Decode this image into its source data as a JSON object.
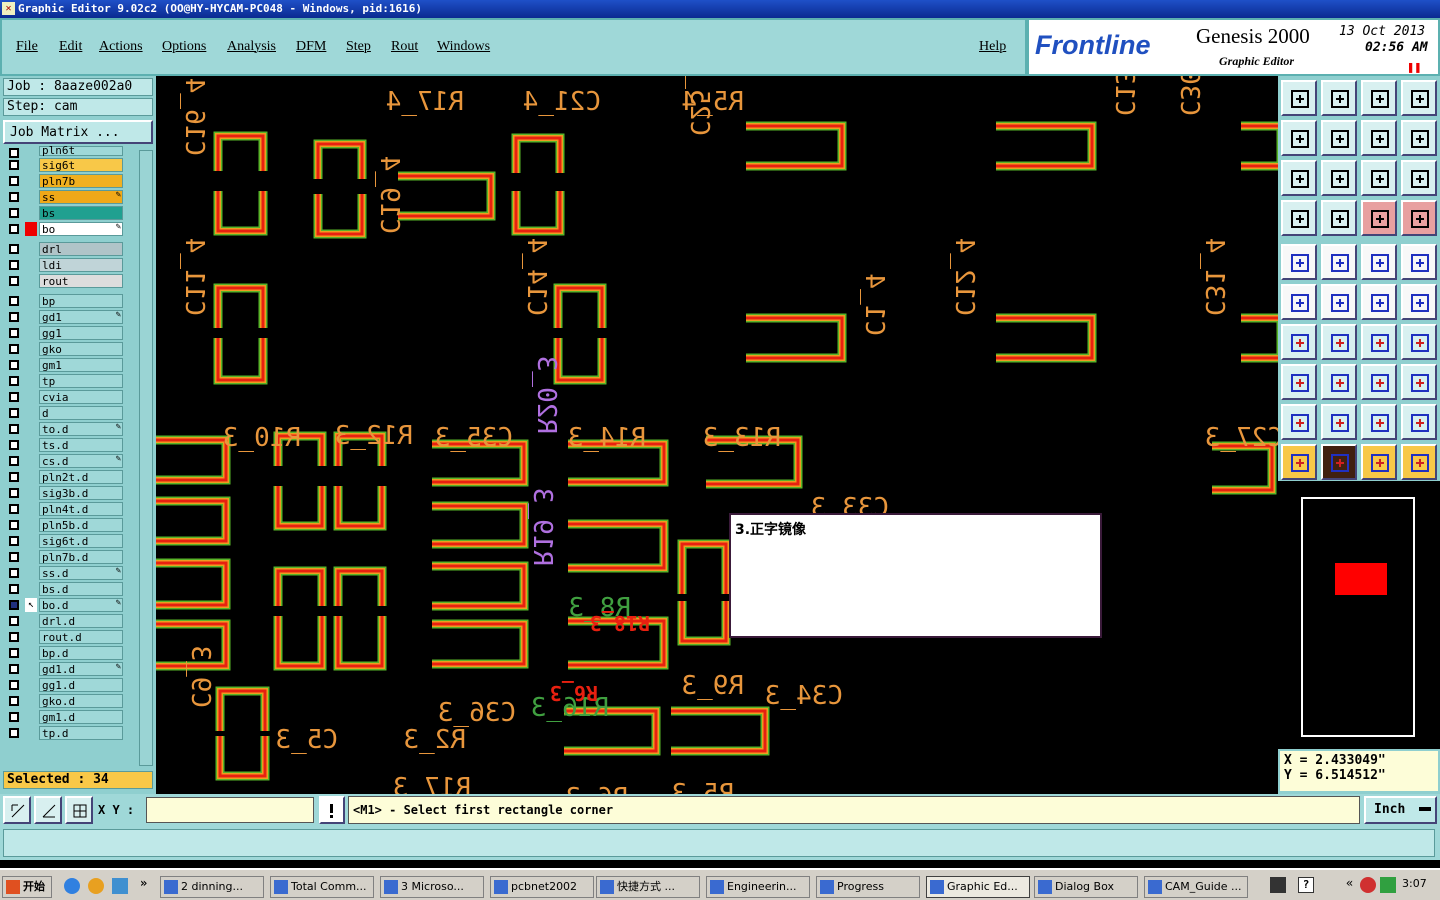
{
  "window": {
    "title": "Graphic Editor 9.02c2 (OO@HY-HYCAM-PC048 - Windows, pid:1616)"
  },
  "menu": [
    "File",
    "Edit",
    "Actions",
    "Options",
    "Analysis",
    "DFM",
    "Step",
    "Rout",
    "Windows"
  ],
  "help": "Help",
  "brand": {
    "logo": "Frontline",
    "product": "Genesis 2000",
    "subtitle": "Graphic Editor",
    "date": "13 Oct 2013",
    "time": "02:56 AM"
  },
  "job": {
    "job_label": "Job : 8aaze002a0",
    "step_label": "Step: cam",
    "matrix_button": "Job Matrix ..."
  },
  "layers": [
    "pln6t",
    "sig6t",
    "pln7b",
    "ss",
    "bs",
    "bo",
    "drl",
    "ldi",
    "rout",
    "bp",
    "gd1",
    "gg1",
    "gko",
    "gm1",
    "tp",
    "cvia",
    "d",
    "to.d",
    "ts.d",
    "cs.d",
    "pln2t.d",
    "sig3b.d",
    "pln4t.d",
    "pln5b.d",
    "sig6t.d",
    "pln7b.d",
    "ss.d",
    "bs.d",
    "bo.d",
    "drl.d",
    "rout.d",
    "bp.d",
    "gd1.d",
    "gg1.d",
    "gko.d",
    "gm1.d",
    "tp.d"
  ],
  "selected": "Selected : 34",
  "coords": {
    "x": "X = 2.433049\"",
    "y": "Y = 6.514512\""
  },
  "dialog": {
    "text": "3.正字镜像"
  },
  "prompt": {
    "xy_label": "X Y :",
    "xy_value": "",
    "message": "<M1> - Select first rectangle corner",
    "units": "Inch"
  },
  "canvas_labels": [
    "R17_4",
    "C21_4",
    "R5_4",
    "C19_4",
    "C25_4",
    "C16_4",
    "C13_4",
    "C30_4",
    "C11_4",
    "C14_4",
    "C1_4",
    "C12_4",
    "C31_4",
    "R10_3",
    "R12_3",
    "C35_3",
    "R14_3",
    "R13_3",
    "C33_3",
    "R8_3",
    "R9_3",
    "C34_3",
    "R16_3",
    "C36_3",
    "R2_3",
    "C5_3",
    "R17_3",
    "R6_3",
    "R5_3",
    "C9_3",
    "C27_3",
    "R20_3",
    "R19_3"
  ],
  "taskbar": {
    "start": "开始",
    "tasks": [
      "2 dinning...",
      "Total Comm...",
      "3 Microso...",
      "pcbnet2002",
      "快捷方式 ...",
      "Engineerin...",
      "Progress",
      "Graphic Ed...",
      "Dialog Box",
      "CAM_Guide ..."
    ],
    "clock": "3:07"
  },
  "colors": {
    "panel": "#9fd8d8",
    "pad_outer": "#58b428",
    "pad_mid": "#f09a20",
    "pad_inner": "#e82010",
    "silk": "#e8963c"
  }
}
